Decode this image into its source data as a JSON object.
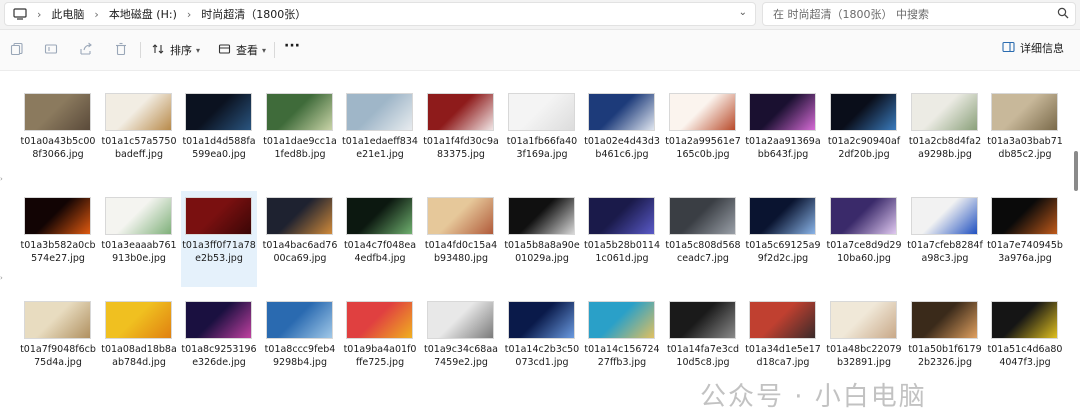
{
  "address_bar": {
    "breadcrumbs": [
      "此电脑",
      "本地磁盘 (H:)",
      "时尚超清（1800张）"
    ],
    "search_placeholder": "在 时尚超清（1800张） 中搜索"
  },
  "command_bar": {
    "sort_label": "排序",
    "view_label": "查看",
    "details_label": "详细信息"
  },
  "files": [
    {
      "name": "t01a0a43b5c008f3066.jpg",
      "colors": [
        "#8b7a5e",
        "#5a4a3a"
      ]
    },
    {
      "name": "t01a1c57a5750badeff.jpg",
      "colors": [
        "#f2ede3",
        "#b88a4a"
      ]
    },
    {
      "name": "t01a1d4d588fa599ea0.jpg",
      "colors": [
        "#0b1220",
        "#2a5580"
      ]
    },
    {
      "name": "t01a1dae9cc1a1fed8b.jpg",
      "colors": [
        "#3f6b3a",
        "#c9d4a8"
      ]
    },
    {
      "name": "t01a1edaeff834e21e1.jpg",
      "colors": [
        "#9fb6c8",
        "#e8ecef"
      ]
    },
    {
      "name": "t01a1f4fd30c9a83375.jpg",
      "colors": [
        "#8e1b1b",
        "#f1e6e6"
      ]
    },
    {
      "name": "t01a1fb66fa403f169a.jpg",
      "colors": [
        "#f4f4f4",
        "#dcdcdc"
      ]
    },
    {
      "name": "t01a02e4d43d3b461c6.jpg",
      "colors": [
        "#1d3b7a",
        "#e0e6f0"
      ]
    },
    {
      "name": "t01a2a99561e7165c0b.jpg",
      "colors": [
        "#fbf4ee",
        "#b84a2a"
      ]
    },
    {
      "name": "t01a2aa91369abb643f.jpg",
      "colors": [
        "#1a1030",
        "#d66bd6"
      ]
    },
    {
      "name": "t01a2c90940af2df20b.jpg",
      "colors": [
        "#0a0e1a",
        "#3a7bbd"
      ]
    },
    {
      "name": "t01a2cb8d4fa2a9298b.jpg",
      "colors": [
        "#ecebe4",
        "#8aa07a"
      ]
    },
    {
      "name": "t01a3a03bab71db85c2.jpg",
      "colors": [
        "#c8b89a",
        "#7a6a4a"
      ]
    },
    {
      "name": "t01a3b582a0cb574e27.jpg",
      "colors": [
        "#120404",
        "#e05a10"
      ]
    },
    {
      "name": "t01a3eaaab761913b0e.jpg",
      "colors": [
        "#f4f4f0",
        "#7fb07a"
      ]
    },
    {
      "name": "t01a3ff0f71a78e2b53.jpg",
      "colors": [
        "#7a1010",
        "#3a0606"
      ]
    },
    {
      "name": "t01a4bac6ad7600ca69.jpg",
      "colors": [
        "#1e2230",
        "#d08a3a"
      ]
    },
    {
      "name": "t01a4c7f048ea4edfb4.jpg",
      "colors": [
        "#0c1810",
        "#6fb06f"
      ]
    },
    {
      "name": "t01a4fd0c15a4b93480.jpg",
      "colors": [
        "#e6c89a",
        "#b05a3a"
      ]
    },
    {
      "name": "t01a5b8a8a90e01029a.jpg",
      "colors": [
        "#101010",
        "#d8d8d8"
      ]
    },
    {
      "name": "t01a5b28b01141c061d.jpg",
      "colors": [
        "#1a1a4a",
        "#5a5ac8"
      ]
    },
    {
      "name": "t01a5c808d568ceadc7.jpg",
      "colors": [
        "#3a3e44",
        "#9aa0a8"
      ]
    },
    {
      "name": "t01a5c69125a99f2d2c.jpg",
      "colors": [
        "#0a1430",
        "#8ab4e8"
      ]
    },
    {
      "name": "t01a7ce8d9d2910ba60.jpg",
      "colors": [
        "#3a2a6a",
        "#e0c8f0"
      ]
    },
    {
      "name": "t01a7cfeb8284fa98c3.jpg",
      "colors": [
        "#f2f2f2",
        "#2050c0"
      ]
    },
    {
      "name": "t01a7e740945b3a976a.jpg",
      "colors": [
        "#0a0a0a",
        "#c05a1a"
      ]
    },
    {
      "name": "t01a7f9048f6cb75d4a.jpg",
      "colors": [
        "#e8dcc0",
        "#b09060"
      ]
    },
    {
      "name": "t01a08ad18b8aab784d.jpg",
      "colors": [
        "#f0c020",
        "#e08010"
      ]
    },
    {
      "name": "t01a8c9253196e326de.jpg",
      "colors": [
        "#1a1040",
        "#c040a0"
      ]
    },
    {
      "name": "t01a8ccc9feb49298b4.jpg",
      "colors": [
        "#2a6ab0",
        "#a0c8e8"
      ]
    },
    {
      "name": "t01a9ba4a01f0ffe725.jpg",
      "colors": [
        "#e04040",
        "#f0b020"
      ]
    },
    {
      "name": "t01a9c34c68aa7459e2.jpg",
      "colors": [
        "#e8e8e8",
        "#7a7a7a"
      ]
    },
    {
      "name": "t01a14c2b3c50073cd1.jpg",
      "colors": [
        "#0a1a4a",
        "#6a9ae0"
      ]
    },
    {
      "name": "t01a14c15672427ffb3.jpg",
      "colors": [
        "#2aa0c8",
        "#e0c060"
      ]
    },
    {
      "name": "t01a14fa7e3cd10d5c8.jpg",
      "colors": [
        "#1a1a1a",
        "#8a8a8a"
      ]
    },
    {
      "name": "t01a34d1e5e17d18ca7.jpg",
      "colors": [
        "#c04030",
        "#3a2a2a"
      ]
    },
    {
      "name": "t01a48bc22079b32891.jpg",
      "colors": [
        "#f0e8d8",
        "#c8a888"
      ]
    },
    {
      "name": "t01a50b1f61792b2326.jpg",
      "colors": [
        "#3a2a1a",
        "#e0a060"
      ]
    },
    {
      "name": "t01a51c4d6a804047f3.jpg",
      "colors": [
        "#151515",
        "#e0c020"
      ]
    }
  ],
  "watermark": "公众号 · 小白电脑"
}
